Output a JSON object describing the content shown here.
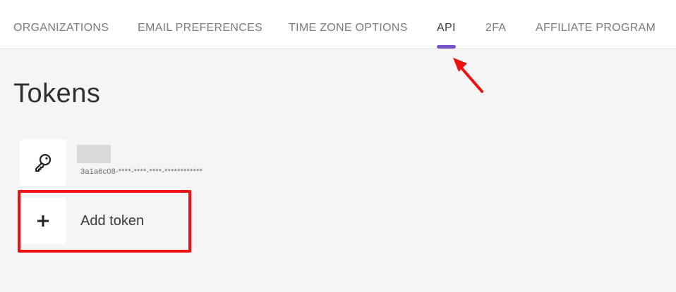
{
  "nav": {
    "tabs": [
      {
        "label": "ORGANIZATIONS"
      },
      {
        "label": "EMAIL PREFERENCES"
      },
      {
        "label": "TIME ZONE OPTIONS"
      },
      {
        "label": "API"
      },
      {
        "label": "2FA"
      },
      {
        "label": "AFFILIATE PROGRAM"
      }
    ],
    "active_tab": "API"
  },
  "page": {
    "title": "Tokens"
  },
  "tokens": [
    {
      "icon": "key-icon",
      "id_masked": "3a1a6c08-****-****-****-************"
    }
  ],
  "add_token": {
    "icon": "plus-icon",
    "label": "Add token"
  },
  "colors": {
    "accent": "#7a52c7",
    "annotation": "#ee1111",
    "background": "#f5f5f5"
  }
}
